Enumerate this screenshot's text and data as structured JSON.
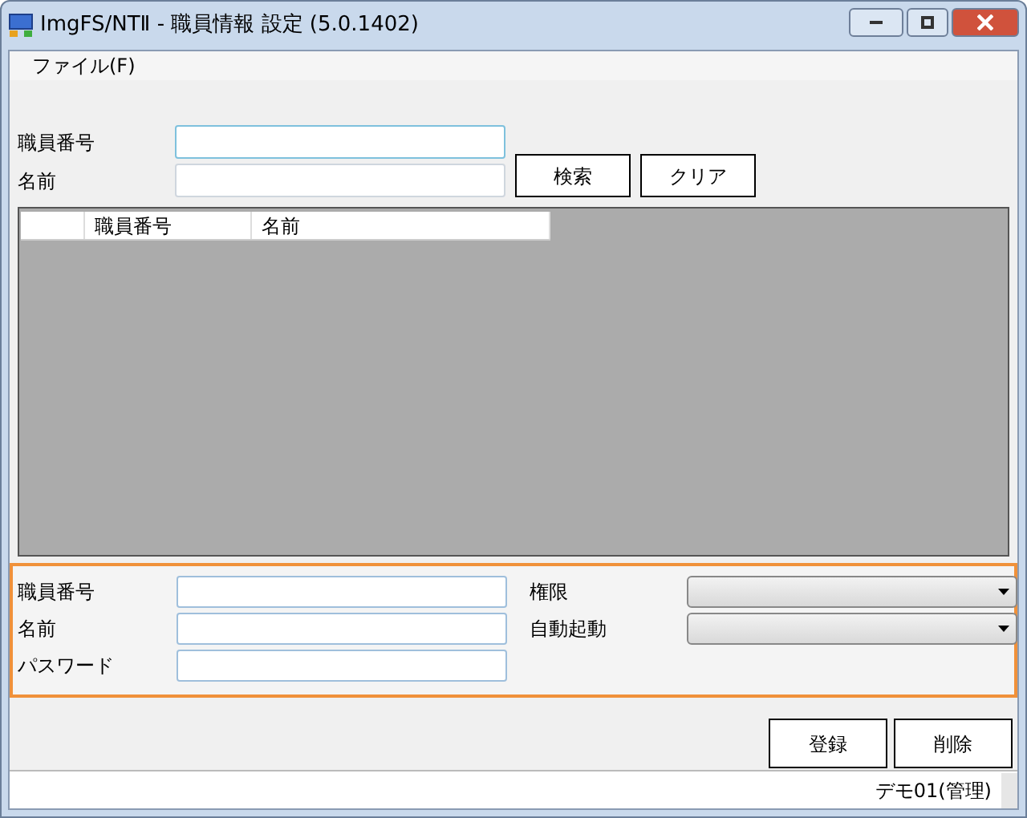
{
  "window": {
    "title": "ImgFS/NTⅡ - 職員情報 設定 (5.0.1402)"
  },
  "menu": [
    {
      "label": "ファイル(F)"
    }
  ],
  "search": {
    "fields": [
      {
        "label": "職員番号",
        "focused": true
      },
      {
        "label": "名前",
        "focused": false
      }
    ],
    "buttons": [
      "検索",
      "クリア"
    ]
  },
  "table": {
    "columns": [
      "職員番号",
      "名前"
    ]
  },
  "detail": {
    "fields": [
      {
        "label": "職員番号",
        "kind": "text"
      },
      {
        "label": "名前",
        "kind": "text"
      },
      {
        "label": "パスワード",
        "kind": "text"
      }
    ],
    "selects": [
      {
        "label": "権限"
      },
      {
        "label": "自動起動"
      }
    ]
  },
  "buttons": [
    "登録",
    "削除"
  ],
  "status_bar": {
    "user": "デモ01(管理)"
  }
}
